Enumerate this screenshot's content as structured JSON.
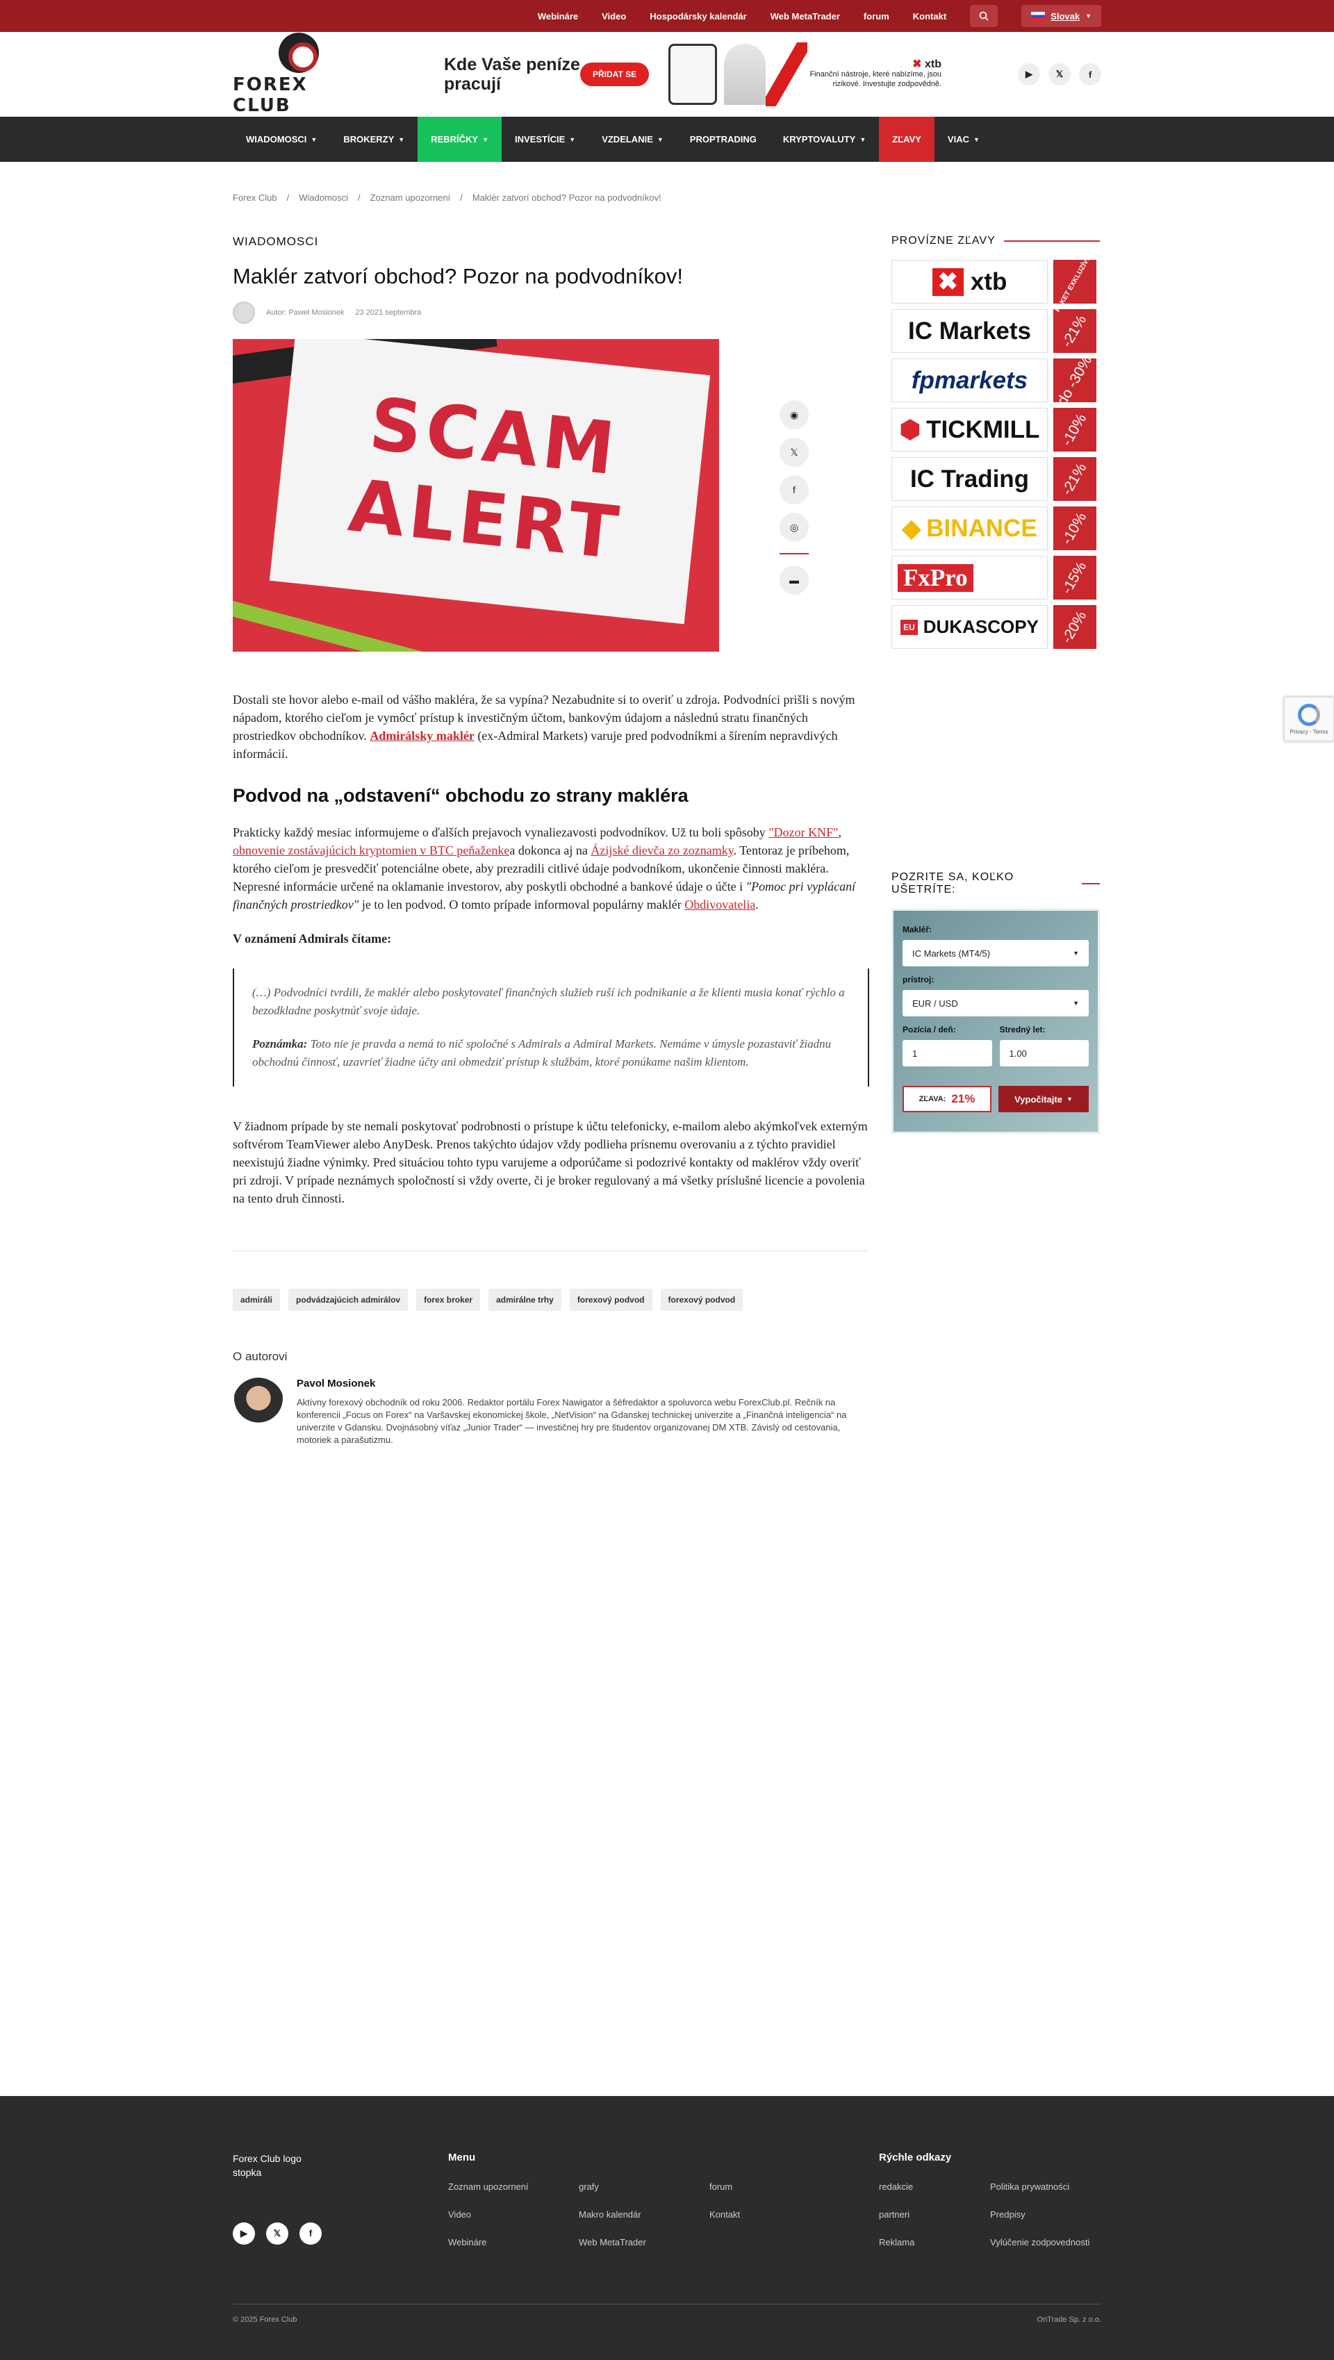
{
  "topbar": {
    "links": [
      "Webináre",
      "Video",
      "Hospodársky kalendár",
      "Web MetaTrader",
      "forum",
      "Kontakt"
    ],
    "language": "Slovak"
  },
  "header": {
    "logo_text": "FOREX CLUB",
    "banner": {
      "title": "Kde Vaše peníze pracují",
      "button": "PŘIDAT SE",
      "brand": "xtb",
      "disclaimer": "Finanční nástroje, které nabízíme, jsou rizikové. Investujte zodpovědně."
    }
  },
  "nav": [
    {
      "label": "WIADOMOSCI",
      "chevron": true
    },
    {
      "label": "BROKERZY",
      "chevron": true
    },
    {
      "label": "REBRÍČKY",
      "chevron": true
    },
    {
      "label": "INVESTÍCIE",
      "chevron": true
    },
    {
      "label": "VZDELANIE",
      "chevron": true
    },
    {
      "label": "PROPTRADING",
      "chevron": false
    },
    {
      "label": "KRYPTOVALUTY",
      "chevron": true
    },
    {
      "label": "ZĽAVY",
      "chevron": false
    },
    {
      "label": "VIAC",
      "chevron": true
    }
  ],
  "breadcrumb": [
    "Forex Club",
    "Wiadomosci",
    "Zoznam upozornení",
    "Maklér zatvorí obchod? Pozor na podvodníkov!"
  ],
  "article": {
    "category": "WIADOMOSCI",
    "title": "Maklér zatvorí obchod? Pozor na podvodníkov!",
    "author": "Autor: Paweł Mosionek",
    "date": "23 2021 septembra",
    "hero_text": [
      "SCAM",
      "ALERT"
    ],
    "intro_1": "Dostali ste hovor alebo e-mail od vášho makléra, že sa vypína? Nezabudnite si to overiť u zdroja. Podvodníci prišli s novým nápadom, ktorého cieľom je vymôcť prístup k investičným účtom, bankovým údajom a následnú stratu finančných prostriedkov obchodníkov.",
    "intro_link": "Admirálsky maklér",
    "intro_2": " (ex-Admiral Markets) varuje pred podvodníkmi a šírením nepravdivých informácií.",
    "h2": "Podvod na „odstavení“ obchodu zo strany makléra",
    "p2_a": "Prakticky každý mesiac informujeme o ďalších prejavoch vynaliezavosti podvodníkov. Už tu boli spôsoby ",
    "p2_link1": "\"Dozor KNF\"",
    "p2_b": ", ",
    "p2_link2": "obnovenie zostávajúcich kryptomien v BTC peňaženke",
    "p2_c": "a dokonca aj na ",
    "p2_link3": "Ázijské dievča zo zoznamky",
    "p2_d": ". Tentoraz je príbehom, ktorého cieľom je presvedčiť potenciálne obete, aby prezradili citlivé údaje podvodníkom, ukončenie činnosti makléra. Nepresné informácie určené na oklamanie investorov, aby poskytli obchodné a bankové údaje o účte i ",
    "p2_italic": "\"Pomoc pri vyplácaní finančných prostriedkov\"",
    "p2_e": " je to len podvod. O tomto prípade informoval populárny maklér ",
    "p2_link4": "Obdivovatelia",
    "p2_f": ".",
    "strong": "V oznámení Admirals čítame:",
    "quote_1": "(…) Podvodníci tvrdili, že maklér alebo poskytovateľ finančných služieb ruší ich podnikanie a že klienti musia konať rýchlo a bezodkladne poskytnúť svoje údaje.",
    "quote_2_label": "Poznámka:",
    "quote_2": " Toto nie je pravda a nemá to nič spoločné s Admirals a Admiral Markets. Nemáme v úmysle pozastaviť žiadnu obchodnú činnosť, uzavrieť žiadne účty ani obmedziť prístup k službám, ktoré ponúkame našim klientom.",
    "p3": "V žiadnom prípade by ste nemali poskytovať podrobnosti o prístupe k účtu telefonicky, e-mailom alebo akýmkoľvek externým softvérom TeamViewer alebo AnyDesk. Prenos takýchto údajov vždy podlieha prísnemu overovaniu a z týchto pravidiel neexistujú žiadne výnimky. Pred situáciou tohto typu varujeme a odporúčame si podozrivé kontakty od maklérov vždy overiť pri zdroji. V prípade neznámych spoločností si vždy overte, či je broker regulovaný a má všetky príslušné licencie a povolenia na tento druh činnosti.",
    "tags": [
      "admiráli",
      "podvádzajúcich admirálov",
      "forex broker",
      "admirálne trhy",
      "forexový podvod",
      "forexový podvod"
    ],
    "about_heading": "O autorovi",
    "author_name": "Pavol Mosionek",
    "author_bio": "Aktívny forexový obchodník od roku 2006. Redaktor portálu Forex Nawigator a šéfredaktor a spoluvorca webu ForexClub.pl. Rečník na konferencii „Focus on Forex“ na Varšavskej ekonomickej škole, „NetVision“ na Gdanskej technickej univerzite a „Finančná inteligencia“ na univerzite v Gdansku. Dvojnásobný víťaz „Junior Trader“ — investičnej hry pre študentov organizovanej DM XTB. Závislý od cestovania, motoriek a parašutizmu."
  },
  "sidebar": {
    "title": "PROVÍZNE ZĽAVY",
    "brokers": [
      {
        "name": "xtb",
        "discount": "PAKET EXKLUZÍVNY",
        "small": true
      },
      {
        "name": "IC Markets",
        "discount": "-21%",
        "small": false
      },
      {
        "name": "fpmarkets",
        "discount": "do -30%",
        "small": false
      },
      {
        "name": "TICKMILL",
        "discount": "-10%",
        "small": false
      },
      {
        "name": "IC Trading",
        "discount": "-21%",
        "small": false
      },
      {
        "name": "BINANCE",
        "discount": "-10%",
        "small": false
      },
      {
        "name": "FxPro",
        "discount": "-15%",
        "small": false
      },
      {
        "name": "DUKASCOPY",
        "discount": "-20%",
        "small": false
      }
    ],
    "calc_title": "POZRITE SA, KOĽKO UŠETRÍTE:",
    "calc": {
      "broker_label": "Makléř:",
      "broker_value": "IC Markets (MT4/5)",
      "instrument_label": "prístroj:",
      "instrument_value": "EUR / USD",
      "positions_label": "Pozícia / deň:",
      "positions_value": "1",
      "lots_label": "Stredný let:",
      "lots_value": "1.00",
      "discount_label": "ZĽAVA:",
      "discount_value": "21%",
      "button": "Vypočítajte"
    }
  },
  "recaptcha": {
    "text": "Privacy - Terms"
  },
  "footer": {
    "logo_alt": "Forex Club logo stopka",
    "menu_title": "Menu",
    "menu": [
      "Zoznam upozornení",
      "grafy",
      "forum",
      "Video",
      "Makro kalendár",
      "Kontakt",
      "Webináre",
      "Web MetaTrader"
    ],
    "quick_title": "Rýchle odkazy",
    "quick": [
      "redakcie",
      "Politika prywatności",
      "partneri",
      "Predpisy",
      "Reklama",
      "Vylúčenie zodpovednosti"
    ],
    "copyright": "© 2025 Forex Club",
    "company": "OnTrade Sp. z o.o."
  }
}
